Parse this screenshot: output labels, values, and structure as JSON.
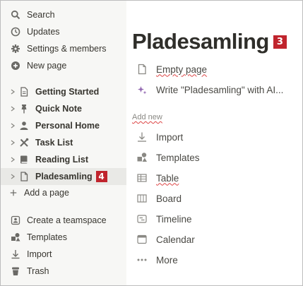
{
  "sidebar": {
    "top_items": [
      {
        "label": "Search",
        "icon": "search-icon"
      },
      {
        "label": "Updates",
        "icon": "clock-icon"
      },
      {
        "label": "Settings & members",
        "icon": "gear-icon"
      },
      {
        "label": "New page",
        "icon": "plus-circle-icon"
      }
    ],
    "pages": [
      {
        "label": "Getting Started",
        "icon": "document-icon"
      },
      {
        "label": "Quick Note",
        "icon": "pushpin-icon"
      },
      {
        "label": "Personal Home",
        "icon": "person-icon"
      },
      {
        "label": "Task List",
        "icon": "tools-icon"
      },
      {
        "label": "Reading List",
        "icon": "book-icon"
      },
      {
        "label": "Pladesamling",
        "icon": "document-icon",
        "badge": "4",
        "selected": true
      }
    ],
    "add_page_label": "Add a page",
    "bottom_items": [
      {
        "label": "Create a teamspace",
        "icon": "teamspace-icon"
      },
      {
        "label": "Templates",
        "icon": "shapes-icon"
      },
      {
        "label": "Import",
        "icon": "download-icon"
      },
      {
        "label": "Trash",
        "icon": "trash-icon"
      }
    ]
  },
  "main": {
    "title": "Pladesamling",
    "title_badge": "3",
    "options": [
      {
        "label": "Empty page",
        "icon": "document-icon"
      },
      {
        "label": "Write \"Pladesamling\" with AI...",
        "icon": "sparkle-icon"
      }
    ],
    "add_new_label": "Add new",
    "add_new_items": [
      {
        "label": "Import",
        "icon": "download-icon"
      },
      {
        "label": "Templates",
        "icon": "shapes-icon"
      },
      {
        "label": "Table",
        "icon": "table-icon"
      },
      {
        "label": "Board",
        "icon": "board-icon"
      },
      {
        "label": "Timeline",
        "icon": "timeline-icon"
      },
      {
        "label": "Calendar",
        "icon": "calendar-icon"
      },
      {
        "label": "More",
        "icon": "more-dots-icon"
      }
    ]
  },
  "colors": {
    "sidebar_bg": "#f7f7f5",
    "selected_bg": "#e9e9e6",
    "badge_red": "#c0242d",
    "sparkle_purple": "#9065b0"
  }
}
